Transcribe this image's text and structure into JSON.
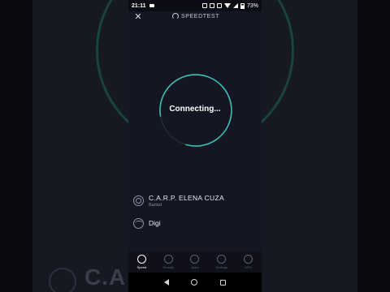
{
  "background": {
    "blurred_text": "C.A"
  },
  "status_bar": {
    "time": "21:11",
    "battery": "73%"
  },
  "app_bar": {
    "close_icon": "close-icon",
    "brand": "SPEEDTEST"
  },
  "gauge": {
    "status": "Connecting...",
    "accent_color": "#3bbfb2"
  },
  "server": {
    "name": "C.A.R.P. ELENA CUZA",
    "location": "Barlad"
  },
  "isp": {
    "name": "Digi"
  },
  "tabs": [
    {
      "label": "Speed",
      "icon": "speedometer-icon",
      "active": true
    },
    {
      "label": "Results",
      "icon": "check-circle-icon",
      "active": false
    },
    {
      "label": "Apps",
      "icon": "rocket-icon",
      "active": false
    },
    {
      "label": "Settings",
      "icon": "gear-icon",
      "active": false
    },
    {
      "label": "VPN",
      "icon": "globe-icon",
      "active": false
    }
  ]
}
